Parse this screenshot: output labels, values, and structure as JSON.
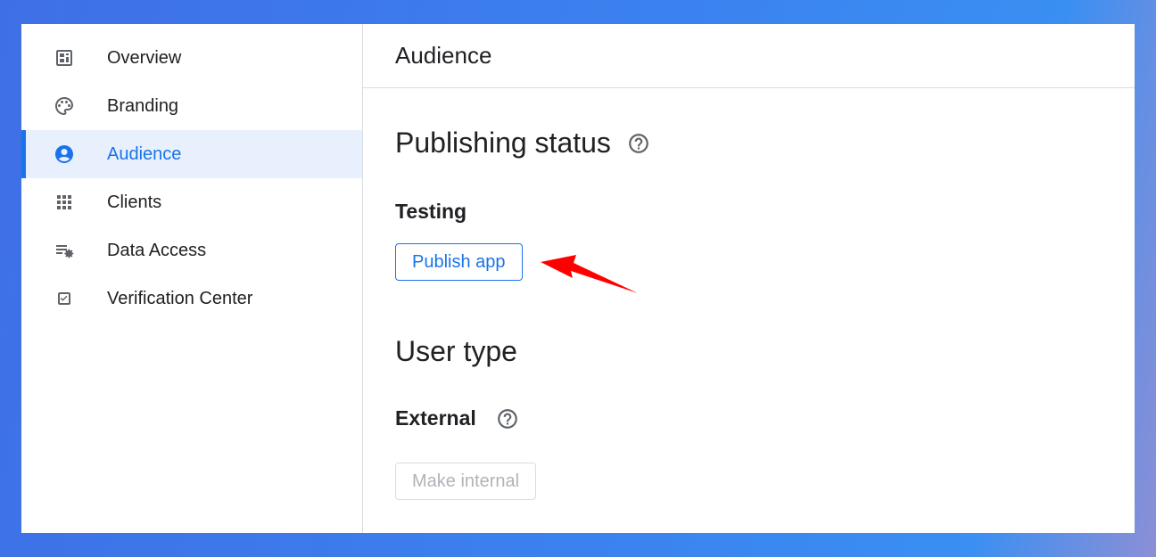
{
  "sidebar": {
    "items": [
      {
        "label": "Overview",
        "icon": "dashboard-icon"
      },
      {
        "label": "Branding",
        "icon": "palette-icon"
      },
      {
        "label": "Audience",
        "icon": "account-circle-icon",
        "active": true
      },
      {
        "label": "Clients",
        "icon": "apps-grid-icon"
      },
      {
        "label": "Data Access",
        "icon": "list-settings-icon"
      },
      {
        "label": "Verification Center",
        "icon": "checkbox-icon"
      }
    ]
  },
  "main": {
    "header_title": "Audience",
    "publishing": {
      "title": "Publishing status",
      "status": "Testing",
      "button_label": "Publish app"
    },
    "user_type": {
      "title": "User type",
      "value": "External",
      "button_label": "Make internal"
    }
  },
  "annotation": {
    "type": "arrow",
    "color": "#ff0000",
    "points_to": "Publish app"
  },
  "colors": {
    "accent": "#1a73e8",
    "active_bg": "#e8f0fe",
    "text": "#202124",
    "icon": "#5f6368",
    "disabled_text": "#b0b3b8"
  }
}
